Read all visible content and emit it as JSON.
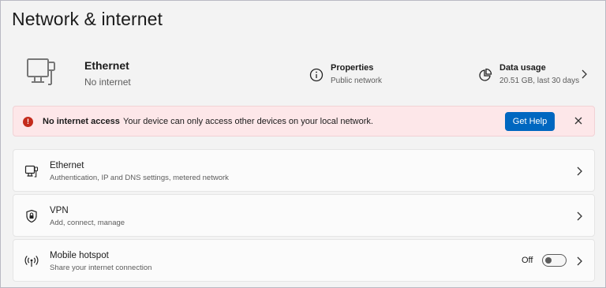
{
  "page": {
    "title": "Network & internet"
  },
  "summary": {
    "connection_name": "Ethernet",
    "connection_status": "No internet",
    "properties": {
      "title": "Properties",
      "subtitle": "Public network",
      "icon": "info-icon"
    },
    "data_usage": {
      "title": "Data usage",
      "subtitle": "20.51 GB, last 30 days",
      "icon": "pie-chart-icon"
    }
  },
  "banner": {
    "title": "No internet access",
    "message": "Your device can only access other devices on your local network.",
    "button_label": "Get Help",
    "error_glyph": "!",
    "colors": {
      "background": "#fde7e9",
      "icon": "#c42b1c",
      "button": "#0067c0"
    }
  },
  "items": [
    {
      "title": "Ethernet",
      "subtitle": "Authentication, IP and DNS settings, metered network",
      "icon": "ethernet-icon"
    },
    {
      "title": "VPN",
      "subtitle": "Add, connect, manage",
      "icon": "vpn-shield-icon"
    },
    {
      "title": "Mobile hotspot",
      "subtitle": "Share your internet connection",
      "icon": "hotspot-icon",
      "toggle_label": "Off",
      "toggle_on": false
    }
  ]
}
